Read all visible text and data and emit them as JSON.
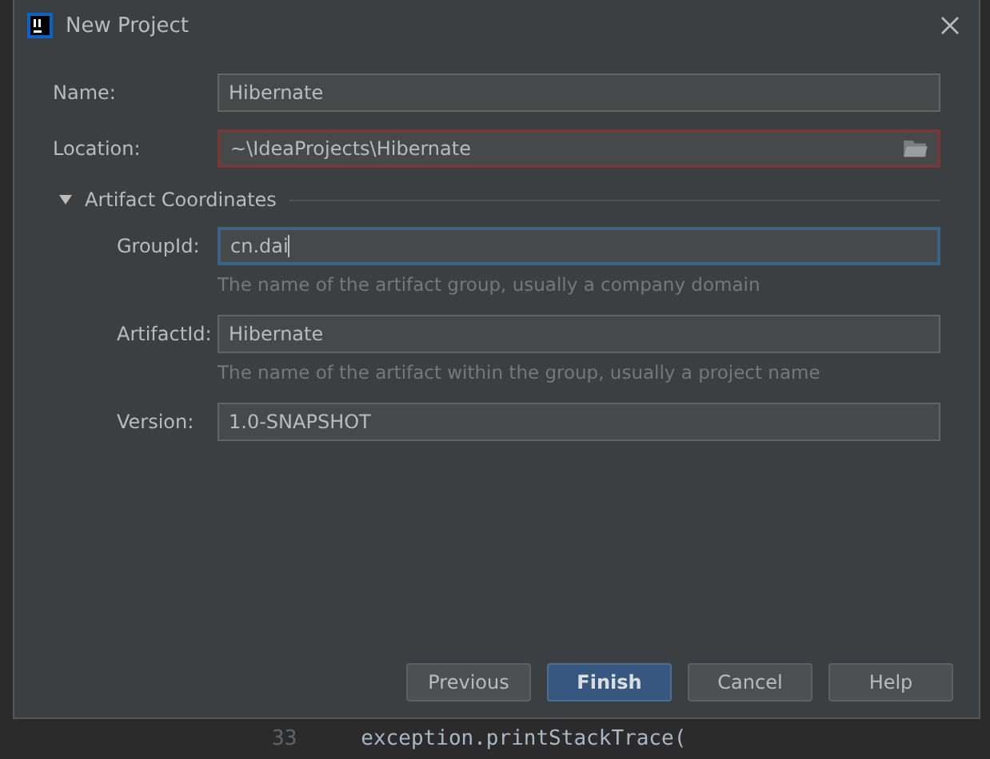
{
  "window": {
    "title": "New Project"
  },
  "fields": [
    {
      "label": "Name:",
      "value": "Hibernate",
      "error": false,
      "focused": false
    },
    {
      "label": "Location:",
      "value": "~\\IdeaProjects\\Hibernate",
      "error": true,
      "focused": false,
      "browse": true
    }
  ],
  "section": {
    "title": "Artifact Coordinates",
    "expanded": true,
    "fields": [
      {
        "label": "GroupId:",
        "value": "cn.dai",
        "focused": true,
        "hint": "The name of the artifact group, usually a company domain"
      },
      {
        "label": "ArtifactId:",
        "value": "Hibernate",
        "focused": false,
        "hint": "The name of the artifact within the group, usually a project name"
      },
      {
        "label": "Version:",
        "value": "1.0-SNAPSHOT",
        "focused": false
      }
    ]
  },
  "buttons": [
    {
      "label": "Previous",
      "primary": false
    },
    {
      "label": "Finish",
      "primary": true
    },
    {
      "label": "Cancel",
      "primary": false
    },
    {
      "label": "Help",
      "primary": false
    }
  ],
  "editor": {
    "line_number": "33",
    "code": "exception.printStackTrace("
  }
}
